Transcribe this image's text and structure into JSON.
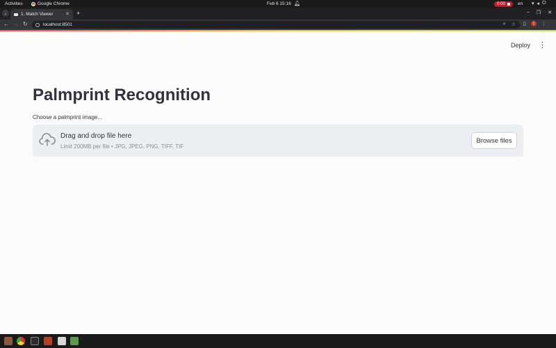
{
  "system_bar": {
    "activities": "Activities",
    "app_name": "Google Chrome",
    "clock": "Feb 6  15:16",
    "recording": "0:00",
    "language": "en"
  },
  "browser": {
    "tab_title": "1. Match Viewer",
    "url": "localhost:8501",
    "profile_badge": "1"
  },
  "page": {
    "deploy_label": "Deploy",
    "title": "Palmprint Recognition",
    "uploader_label": "Choose a palmprint image...",
    "drop_title": "Drag and drop file here",
    "drop_limit": "Limit 200MB per file • JPG, JPEG, PNG, TIFF, TIF",
    "browse_label": "Browse files"
  },
  "colors": {
    "accent_gradient": [
      "#ff4b4b",
      "#ffbd45",
      "#c5d75a"
    ],
    "text": "#31333f",
    "dropzone_bg": "#eceff1",
    "page_bg": "#fbfbf9"
  },
  "dock": {
    "icons": [
      "files-icon",
      "chrome-icon",
      "terminal-icon",
      "text-editor-icon",
      "document-icon",
      "spreadsheet-icon"
    ]
  }
}
